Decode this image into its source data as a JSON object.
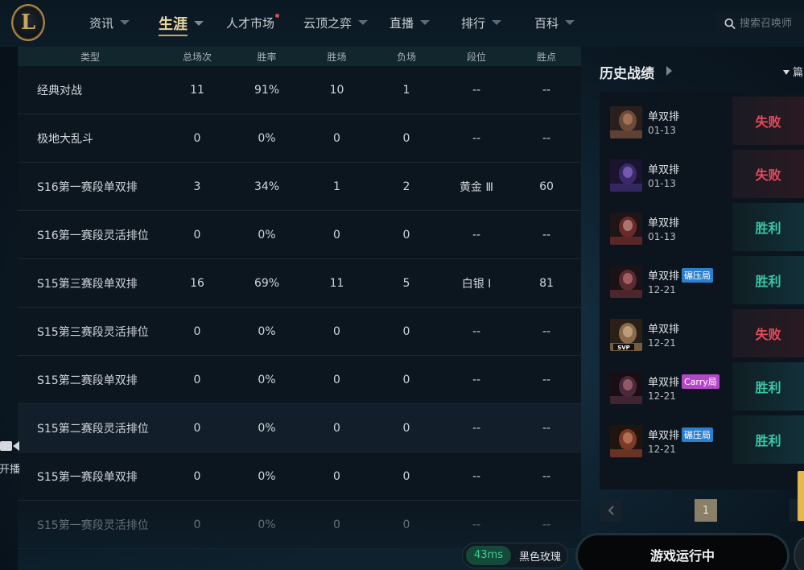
{
  "nav": {
    "logo_letter": "L",
    "items": [
      {
        "label": "资讯"
      },
      {
        "label": "生涯"
      },
      {
        "label": "人才市场"
      },
      {
        "label": "云顶之弈"
      },
      {
        "label": "直播"
      },
      {
        "label": "排行"
      },
      {
        "label": "百科"
      }
    ],
    "search_placeholder": "搜索召唤师"
  },
  "stats": {
    "headers": {
      "type": "类型",
      "total": "总场次",
      "winrate": "胜率",
      "wins": "胜场",
      "losses": "负场",
      "rank": "段位",
      "lp": "胜点"
    },
    "rows": [
      {
        "type": "经典对战",
        "total": "11",
        "winrate": "91%",
        "wins": "10",
        "losses": "1",
        "rank": "--",
        "lp": "--"
      },
      {
        "type": "极地大乱斗",
        "total": "0",
        "winrate": "0%",
        "wins": "0",
        "losses": "0",
        "rank": "--",
        "lp": "--"
      },
      {
        "type": "S16第一赛段单双排",
        "total": "3",
        "winrate": "34%",
        "wins": "1",
        "losses": "2",
        "rank": "黄金 Ⅲ",
        "lp": "60"
      },
      {
        "type": "S16第一赛段灵活排位",
        "total": "0",
        "winrate": "0%",
        "wins": "0",
        "losses": "0",
        "rank": "--",
        "lp": "--"
      },
      {
        "type": "S15第三赛段单双排",
        "total": "16",
        "winrate": "69%",
        "wins": "11",
        "losses": "5",
        "rank": "白银 Ⅰ",
        "lp": "81"
      },
      {
        "type": "S15第三赛段灵活排位",
        "total": "0",
        "winrate": "0%",
        "wins": "0",
        "losses": "0",
        "rank": "--",
        "lp": "--"
      },
      {
        "type": "S15第二赛段单双排",
        "total": "0",
        "winrate": "0%",
        "wins": "0",
        "losses": "0",
        "rank": "--",
        "lp": "--"
      },
      {
        "type": "S15第二赛段灵活排位",
        "total": "0",
        "winrate": "0%",
        "wins": "0",
        "losses": "0",
        "rank": "--",
        "lp": "--"
      },
      {
        "type": "S15第一赛段单双排",
        "total": "0",
        "winrate": "0%",
        "wins": "0",
        "losses": "0",
        "rank": "--",
        "lp": "--"
      },
      {
        "type": "S15第一赛段灵活排位",
        "total": "0",
        "winrate": "0%",
        "wins": "0",
        "losses": "0",
        "rank": "--",
        "lp": "--"
      }
    ]
  },
  "stream": {
    "label": "键开播"
  },
  "history": {
    "title": "历史战绩",
    "filter_label": "篇",
    "matches": [
      {
        "queue": "单双排",
        "date": "01-13",
        "result": "失败",
        "outcome": "lose",
        "tag": "",
        "tag_color": ""
      },
      {
        "queue": "单双排",
        "date": "01-13",
        "result": "失败",
        "outcome": "lose",
        "tag": "",
        "tag_color": ""
      },
      {
        "queue": "单双排",
        "date": "01-13",
        "result": "胜利",
        "outcome": "win",
        "tag": "",
        "tag_color": ""
      },
      {
        "queue": "单双排",
        "date": "12-21",
        "result": "胜利",
        "outcome": "win",
        "tag": "碾压局",
        "tag_color": "blue"
      },
      {
        "queue": "单双排",
        "date": "12-21",
        "result": "失败",
        "outcome": "lose",
        "tag": "",
        "tag_color": ""
      },
      {
        "queue": "单双排",
        "date": "12-21",
        "result": "胜利",
        "outcome": "win",
        "tag": "Carry局",
        "tag_color": "purple"
      },
      {
        "queue": "单双排",
        "date": "12-21",
        "result": "胜利",
        "outcome": "win",
        "tag": "碾压局",
        "tag_color": "blue"
      }
    ],
    "page": "1"
  },
  "bottom": {
    "ping": "43ms",
    "server": "黑色玫瑰",
    "status": "游戏运行中"
  },
  "colors": {
    "win": "#38c9a6",
    "lose": "#e64a5a",
    "gold": "#c8a860"
  }
}
